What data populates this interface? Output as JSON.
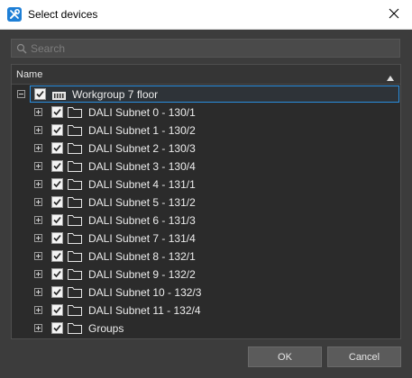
{
  "window": {
    "title": "Select devices",
    "app_icon": "wrench-screwdriver-icon",
    "close_icon": "close-icon"
  },
  "search": {
    "placeholder": "Search",
    "value": "",
    "icon": "search-icon"
  },
  "tree": {
    "column_header": "Name",
    "sort_icon": "sort-ascending-icon",
    "root": {
      "label": "Workgroup 7 floor",
      "checked": true,
      "expanded": true,
      "icon": "device-group-icon"
    },
    "items": [
      {
        "label": "DALI Subnet 0 - 130/1",
        "checked": true,
        "icon": "folder-icon"
      },
      {
        "label": "DALI Subnet 1 - 130/2",
        "checked": true,
        "icon": "folder-icon"
      },
      {
        "label": "DALI Subnet 2 - 130/3",
        "checked": true,
        "icon": "folder-icon"
      },
      {
        "label": "DALI Subnet 3 - 130/4",
        "checked": true,
        "icon": "folder-icon"
      },
      {
        "label": "DALI Subnet 4 - 131/1",
        "checked": true,
        "icon": "folder-icon"
      },
      {
        "label": "DALI Subnet 5 - 131/2",
        "checked": true,
        "icon": "folder-icon"
      },
      {
        "label": "DALI Subnet 6 - 131/3",
        "checked": true,
        "icon": "folder-icon"
      },
      {
        "label": "DALI Subnet 7 - 131/4",
        "checked": true,
        "icon": "folder-icon"
      },
      {
        "label": "DALI Subnet 8 - 132/1",
        "checked": true,
        "icon": "folder-icon"
      },
      {
        "label": "DALI Subnet 9 - 132/2",
        "checked": true,
        "icon": "folder-icon"
      },
      {
        "label": "DALI Subnet 10 - 132/3",
        "checked": true,
        "icon": "folder-icon"
      },
      {
        "label": "DALI Subnet 11 - 132/4",
        "checked": true,
        "icon": "folder-icon"
      },
      {
        "label": "Groups",
        "checked": true,
        "icon": "folder-icon"
      }
    ]
  },
  "buttons": {
    "ok": "OK",
    "cancel": "Cancel"
  },
  "colors": {
    "dialog_background": "#3c3c3c",
    "tree_background": "#2b2b2b",
    "accent": "#1e7fd6",
    "selection_border": "#2a8fe0"
  }
}
